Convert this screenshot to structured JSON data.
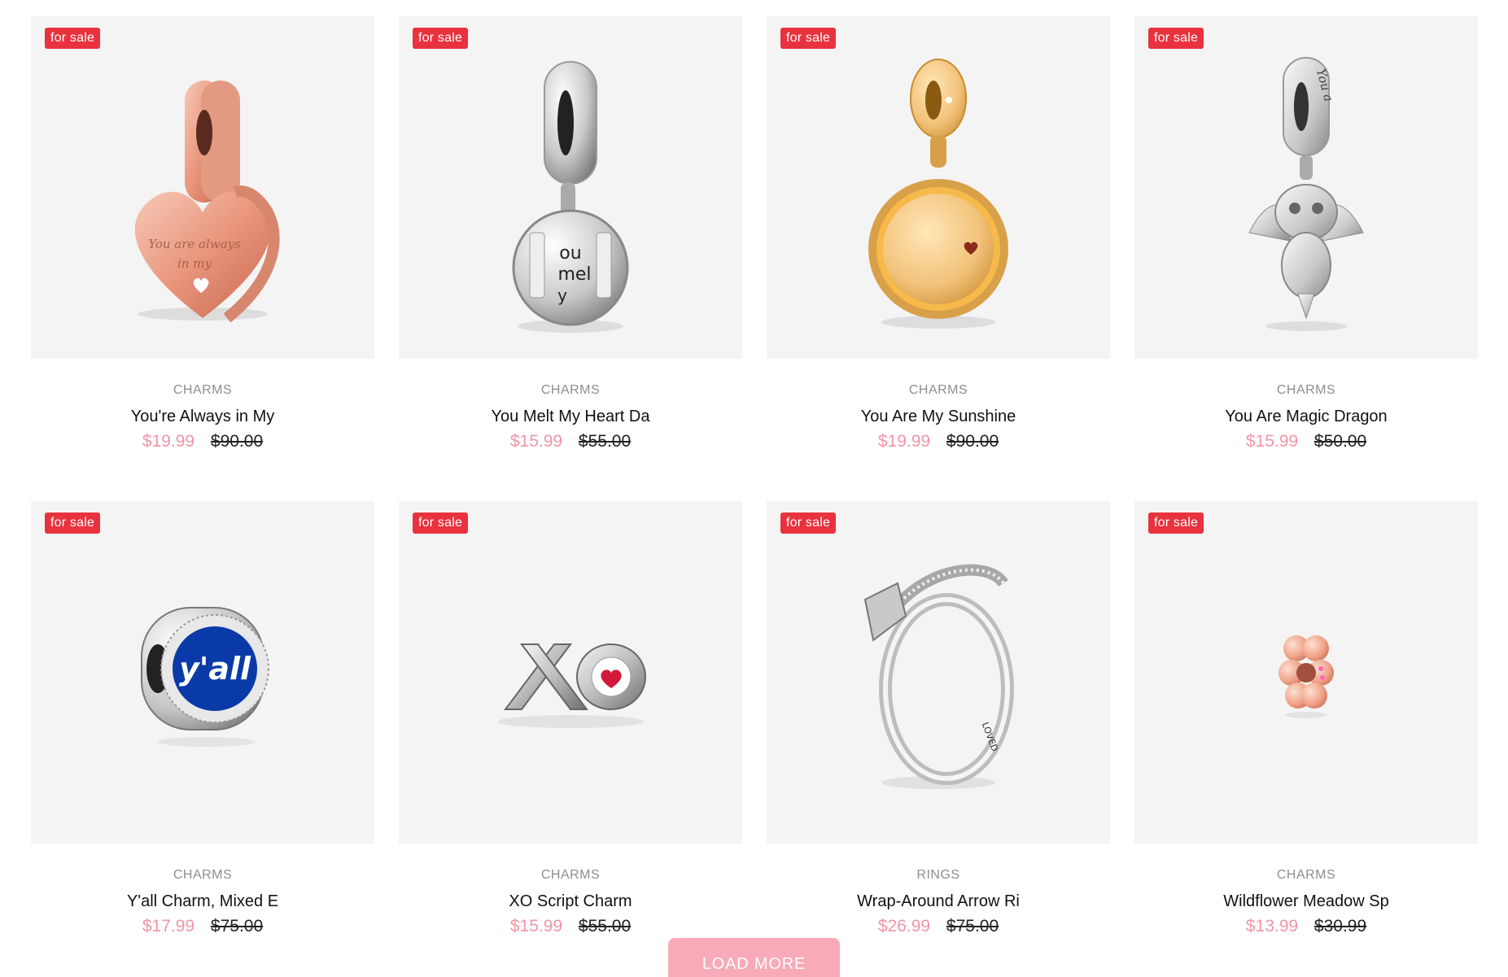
{
  "badge_label": "for sale",
  "load_more_label": "LOAD MORE",
  "products": [
    {
      "category": "CHARMS",
      "title": "You're Always in My",
      "price": "$19.99",
      "old_price": "$90.00",
      "icon": "rose-gold-heart-charm"
    },
    {
      "category": "CHARMS",
      "title": "You Melt My Heart Da",
      "price": "$15.99",
      "old_price": "$55.00",
      "icon": "silver-round-dangle-charm"
    },
    {
      "category": "CHARMS",
      "title": "You Are My Sunshine",
      "price": "$19.99",
      "old_price": "$90.00",
      "icon": "gold-sun-dangle-charm"
    },
    {
      "category": "CHARMS",
      "title": "You Are Magic Dragon",
      "price": "$15.99",
      "old_price": "$50.00",
      "icon": "silver-dragon-charm"
    },
    {
      "category": "CHARMS",
      "title": "Y'all Charm, Mixed E",
      "price": "$17.99",
      "old_price": "$75.00",
      "icon": "yall-blue-charm"
    },
    {
      "category": "CHARMS",
      "title": "XO Script Charm",
      "price": "$15.99",
      "old_price": "$55.00",
      "icon": "xo-charm"
    },
    {
      "category": "RINGS",
      "title": "Wrap-Around Arrow Ri",
      "price": "$26.99",
      "old_price": "$75.00",
      "icon": "arrow-ring"
    },
    {
      "category": "CHARMS",
      "title": "Wildflower Meadow Sp",
      "price": "$13.99",
      "old_price": "$30.99",
      "icon": "flower-spacer-charm"
    }
  ],
  "embedded_text": {
    "heart_engraving_1": "You are always",
    "heart_engraving_2": "in my",
    "melt_engraving_1": "ou",
    "melt_engraving_2": "mel",
    "melt_engraving_3": "y",
    "dragon_engraving": "You a",
    "yall_text": "y'all",
    "ring_engraving": "LOVED"
  },
  "colors": {
    "badge": "#e8323e",
    "sale_price": "#f195a6",
    "load_more_bg": "#f9aab8",
    "thumb_bg": "#f4f4f4"
  }
}
